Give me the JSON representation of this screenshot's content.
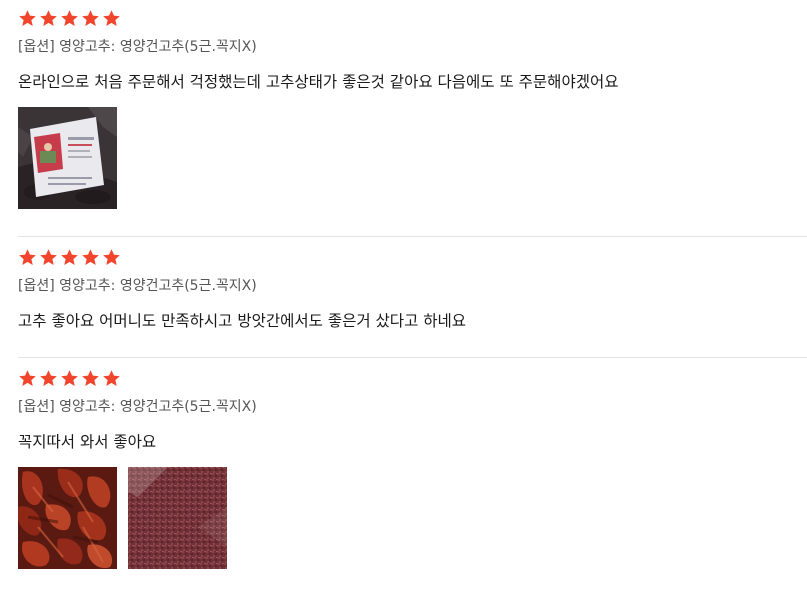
{
  "colors": {
    "star": "#f2452e",
    "divider": "#e2e2e2",
    "option_text": "#555555",
    "review_text": "#1a1a1a"
  },
  "reviews": [
    {
      "rating": 5,
      "option": "[옵션] 영양고추: 영양건고추(5근.꼭지X)",
      "text": "온라인으로 처음 주문해서 걱정했는데 고추상태가 좋은것 같아요 다음에도 또 주문해야겠어요",
      "photos": [
        "package-photo"
      ]
    },
    {
      "rating": 5,
      "option": "[옵션] 영양고추: 영양건고추(5근.꼭지X)",
      "text": "고추 좋아요 어머니도 만족하시고 방앗간에서도 좋은거 샀다고 하네요",
      "photos": []
    },
    {
      "rating": 5,
      "option": "[옵션] 영양고추: 영양건고추(5근.꼭지X)",
      "text": "꼭지따서 와서 좋아요",
      "photos": [
        "dried-peppers-photo",
        "chili-powder-photo"
      ]
    }
  ]
}
